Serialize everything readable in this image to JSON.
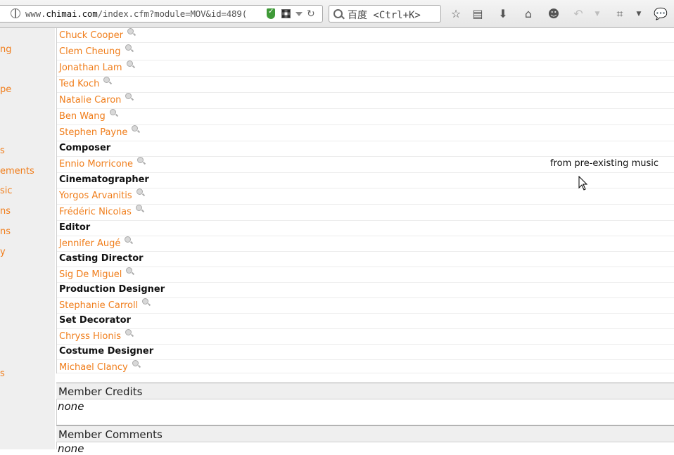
{
  "browser": {
    "url_prefix": "www.",
    "url_domain": "chimai.com",
    "url_path": "/index.cfm?module=MOV&id=489(",
    "search_placeholder": "百度 <Ctrl+K>"
  },
  "sidebar": {
    "items": [
      {
        "label": "ng"
      },
      {
        "label": "pe"
      },
      {
        "label": "s"
      },
      {
        "label": "ements"
      },
      {
        "label": "sic"
      },
      {
        "label": "ns"
      },
      {
        "label": "ns"
      },
      {
        "label": "y"
      },
      {
        "label": "s"
      }
    ]
  },
  "credits": {
    "rows": [
      {
        "type": "name",
        "text": "Chuck Cooper"
      },
      {
        "type": "name",
        "text": "Clem Cheung"
      },
      {
        "type": "name",
        "text": "Jonathan Lam"
      },
      {
        "type": "name",
        "text": "Ted Koch"
      },
      {
        "type": "name",
        "text": "Natalie Caron"
      },
      {
        "type": "name",
        "text": "Ben Wang"
      },
      {
        "type": "name",
        "text": "Stephen Payne"
      },
      {
        "type": "role",
        "text": "Composer"
      },
      {
        "type": "name",
        "text": "Ennio Morricone",
        "note": "from pre-existing music"
      },
      {
        "type": "role",
        "text": "Cinematographer"
      },
      {
        "type": "name",
        "text": "Yorgos Arvanitis"
      },
      {
        "type": "name",
        "text": "Frédéric Nicolas"
      },
      {
        "type": "role",
        "text": "Editor"
      },
      {
        "type": "name",
        "text": "Jennifer Augé"
      },
      {
        "type": "role",
        "text": "Casting Director"
      },
      {
        "type": "name",
        "text": "Sig De Miguel"
      },
      {
        "type": "role",
        "text": "Production Designer"
      },
      {
        "type": "name",
        "text": "Stephanie Carroll"
      },
      {
        "type": "role",
        "text": "Set Decorator"
      },
      {
        "type": "name",
        "text": "Chryss Hionis"
      },
      {
        "type": "role",
        "text": "Costume Designer"
      },
      {
        "type": "name",
        "text": "Michael Clancy"
      }
    ]
  },
  "member_credits": {
    "title": "Member Credits",
    "value": "none"
  },
  "member_comments": {
    "title": "Member Comments",
    "value": "none"
  },
  "colors": {
    "link": "#f07d1a",
    "sidebar_bg": "#efefef"
  }
}
